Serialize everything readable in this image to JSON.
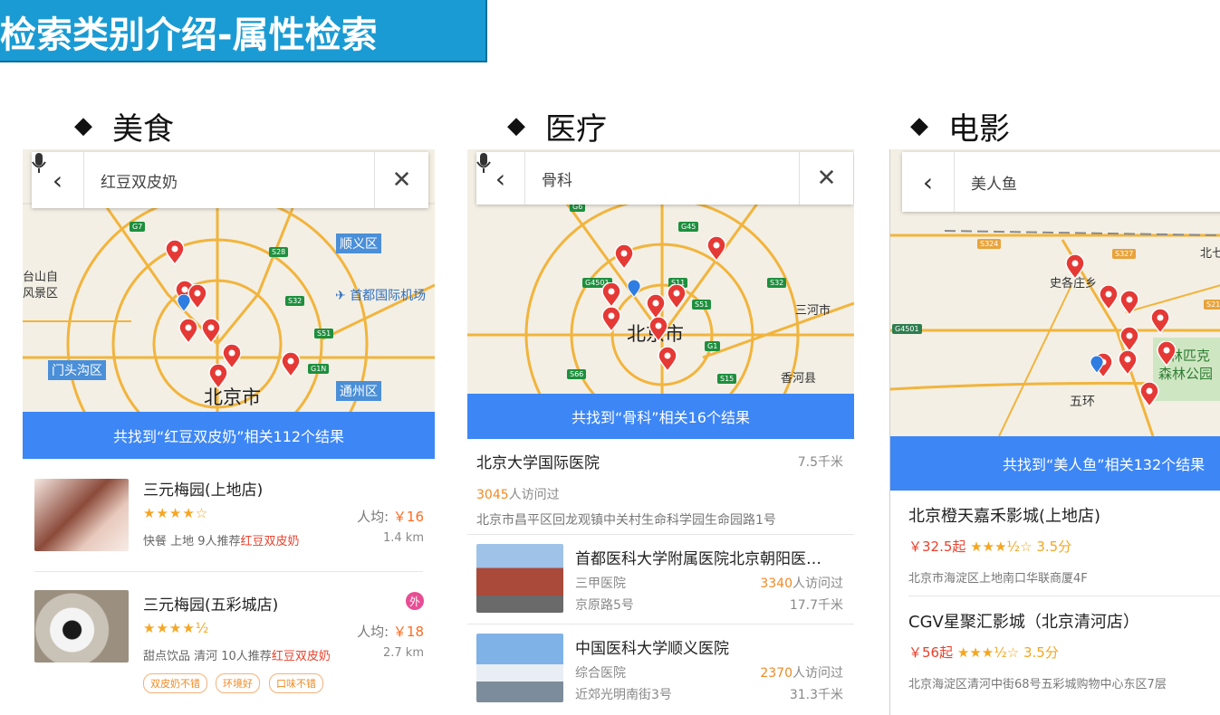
{
  "slide_title": "检索类别介绍-属性检索",
  "sections": [
    {
      "label": "美食"
    },
    {
      "label": "医疗"
    },
    {
      "label": "电影"
    }
  ],
  "food": {
    "query": "红豆双皮奶",
    "banner": "共找到“红豆双皮奶”相关112个结果",
    "map_labels": {
      "city": "北京市",
      "shunyi": "顺义区",
      "airport": "首都国际机场",
      "mentougou": "门头沟区",
      "tongzhou": "通州区",
      "taishan": "台山自",
      "fengjing": "风景区"
    },
    "results": [
      {
        "name": "三元梅园(上地店)",
        "stars": "★★★★☆",
        "price_label": "人均:",
        "price": "￥16",
        "category": "快餐 上地 9人推荐",
        "recommend": "红豆双皮奶",
        "distance": "1.4 km"
      },
      {
        "name": "三元梅园(五彩城店)",
        "stars": "★★★★½",
        "price_label": "人均:",
        "price": "￥18",
        "category": "甜点饮品 清河 10人推荐",
        "recommend": "红豆双皮奶",
        "distance": "2.7 km",
        "badge": "外",
        "tags": [
          "双皮奶不错",
          "环境好",
          "口味不错"
        ]
      }
    ]
  },
  "medical": {
    "query": "骨科",
    "banner": "共找到“骨科”相关16个结果",
    "map_labels": {
      "city": "北京市",
      "sanhe": "三河市",
      "xianghe": "香河县"
    },
    "results": [
      {
        "name": "北京大学国际医院",
        "distance": "7.5千米",
        "visits": "3045",
        "visits_suffix": "人访问过",
        "address": "北京市昌平区回龙观镇中关村生命科学园生命园路1号"
      },
      {
        "name": "首都医科大学附属医院北京朝阳医…",
        "level": "三甲医院",
        "visits": "3340",
        "visits_suffix": "人访问过",
        "address": "京原路5号",
        "distance": "17.7千米"
      },
      {
        "name": "中国医科大学顺义医院",
        "level": "综合医院",
        "visits": "2370",
        "visits_suffix": "人访问过",
        "address": "近郊光明南街3号",
        "distance": "31.3千米"
      }
    ]
  },
  "movie": {
    "query": "美人鱼",
    "banner": "共找到“美人鱼”相关132个结果",
    "map_labels": {
      "shigezhuang": "史各庄乡",
      "wuhuan": "五环",
      "park1": "林匹克",
      "park2": "森林公园",
      "north": "北七"
    },
    "results": [
      {
        "name": "北京橙天嘉禾影城(上地店)",
        "price": "￥32.5",
        "price_suffix": "起",
        "stars": "★★★½☆",
        "rating": "3.5分",
        "address": "北京市海淀区上地南口华联商厦4F"
      },
      {
        "name": "CGV星聚汇影城（北京清河店）",
        "price": "￥56",
        "price_suffix": "起",
        "stars": "★★★½☆",
        "rating": "3.5分",
        "address": "北京海淀区清河中街68号五彩城购物中心东区7层"
      }
    ]
  },
  "colors": {
    "accent": "#1b9bd3",
    "banner": "#3d86f5",
    "price": "#ff6a1f",
    "pin": "#e53935"
  }
}
